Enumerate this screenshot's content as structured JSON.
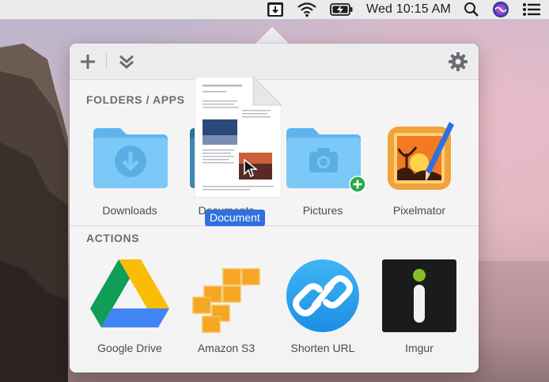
{
  "menubar": {
    "clock": "Wed 10:15 AM",
    "icons": [
      "dropzone-icon",
      "wifi-icon",
      "battery-charging-icon",
      "spotlight-search-icon",
      "siri-icon",
      "notification-center-icon"
    ]
  },
  "toolbar": {
    "add_icon": "plus-icon",
    "collapse_icon": "double-chevron-down-icon",
    "settings_icon": "gear-icon"
  },
  "folders_section": {
    "title": "FOLDERS / APPS",
    "items": [
      {
        "label": "Downloads",
        "icon": "downloads-folder-icon"
      },
      {
        "label": "Documents",
        "icon": "documents-folder-icon"
      },
      {
        "label": "Pictures",
        "icon": "pictures-folder-icon"
      },
      {
        "label": "Pixelmator",
        "icon": "pixelmator-app-icon"
      }
    ]
  },
  "drag": {
    "badge": "Document",
    "icon": "document-thumbnail-icon",
    "pointer": "cursor-arrow-icon",
    "drop_indicator": "add-plus-badge-icon"
  },
  "actions_section": {
    "title": "ACTIONS",
    "items": [
      {
        "label": "Google Drive",
        "icon": "google-drive-icon"
      },
      {
        "label": "Amazon S3",
        "icon": "amazon-s3-icon"
      },
      {
        "label": "Shorten URL",
        "icon": "link-chain-icon"
      },
      {
        "label": "Imgur",
        "icon": "imgur-icon"
      }
    ]
  },
  "colors": {
    "folder_blue": "#6fc0f4",
    "accent_blue": "#2f6fdf",
    "drop_green": "#2aa84a"
  }
}
